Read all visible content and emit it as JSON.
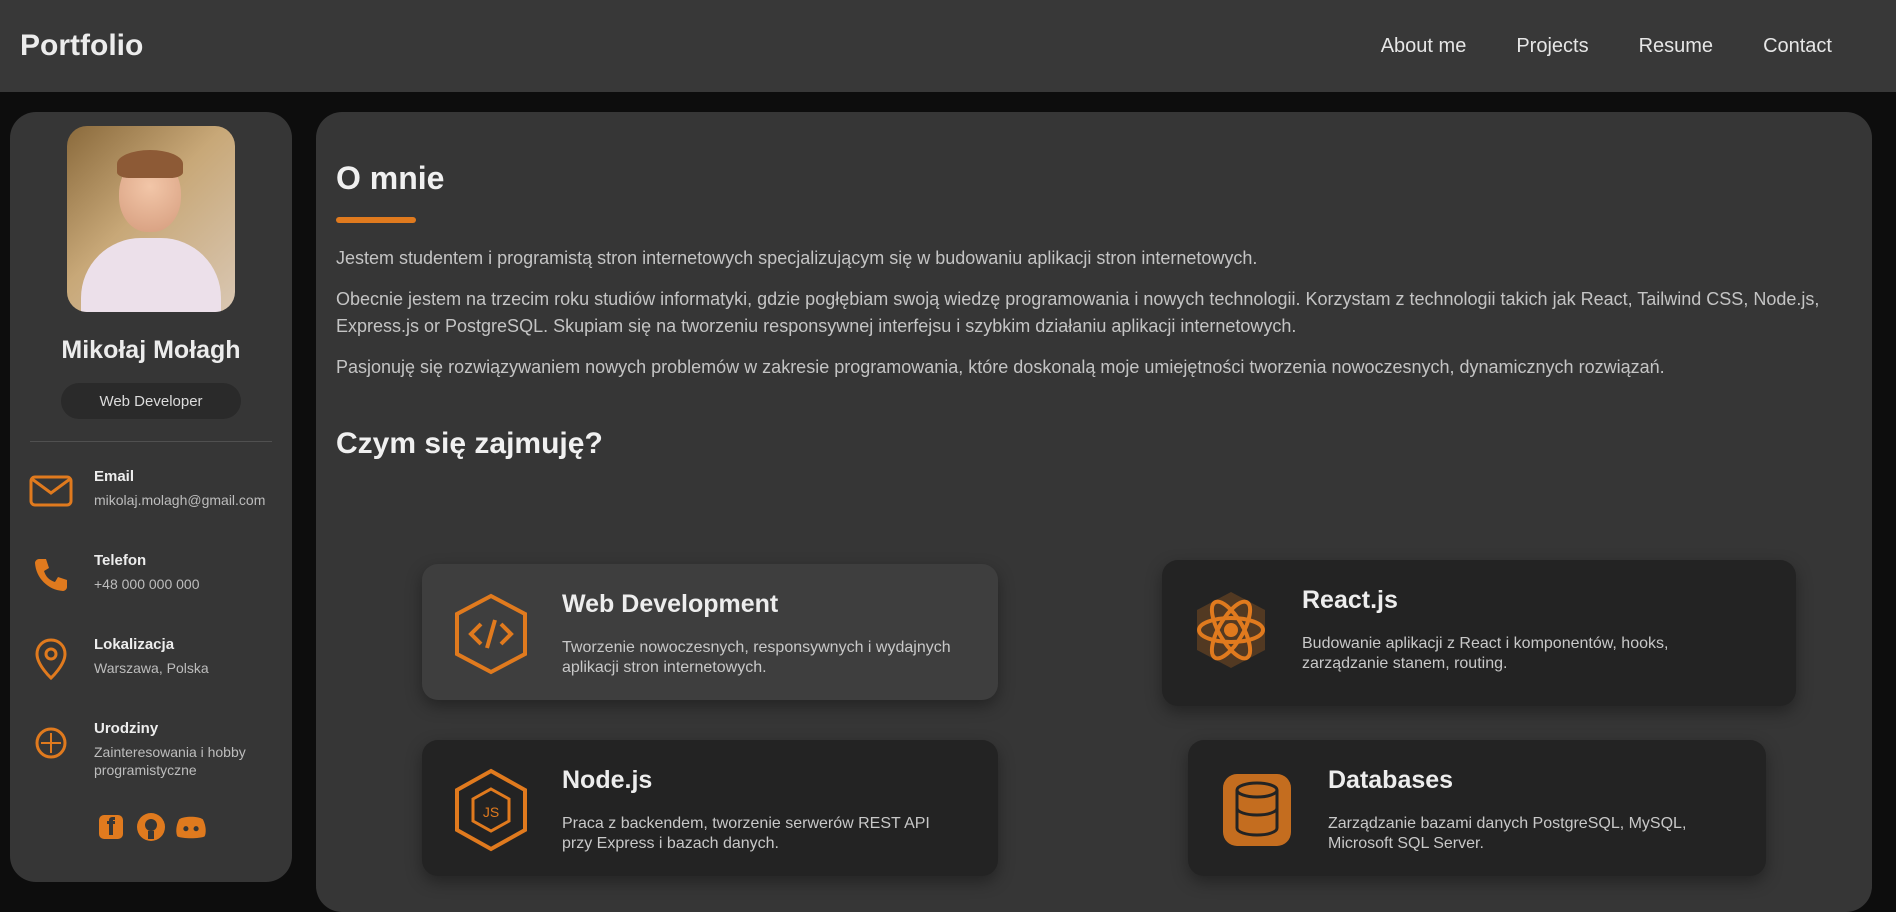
{
  "navbar": {
    "brand": "Portfolio",
    "links": [
      "About me",
      "Projects",
      "Resume",
      "Contact"
    ]
  },
  "sidebar": {
    "name": "Mikołaj Mołagh",
    "role": "Web Developer",
    "contacts": [
      {
        "label": "Email",
        "value": "mikolaj.molagh@gmail.com",
        "icon": "envelope-icon"
      },
      {
        "label": "Telefon",
        "value": "+48 000 000 000",
        "icon": "phone-icon"
      },
      {
        "label": "Lokalizacja",
        "value": "Warszawa, Polska",
        "icon": "location-pin-icon"
      },
      {
        "label": "Urodziny",
        "value": "Zainteresowania i hobby programistyczne",
        "icon": "birthday-icon"
      }
    ],
    "social": [
      "facebook-icon",
      "github-icon",
      "discord-icon"
    ]
  },
  "main": {
    "about_title": "O mnie",
    "paragraphs": [
      "Jestem studentem i programistą stron internetowych specjalizującym się w budowaniu aplikacji stron internetowych.",
      "Obecnie jestem na trzecim roku studiów informatyki, gdzie pogłębiam swoją wiedzę programowania i nowych technologii. Korzystam z technologii takich jak React, Tailwind CSS, Node.js, Express.js or PostgreSQL. Skupiam się na tworzeniu responsywnej interfejsu i szybkim działaniu aplikacji internetowych.",
      "Pasjonuję się rozwiązywaniem nowych problemów w zakresie programowania, które doskonalą moje umiejętności tworzenia nowoczesnych, dynamicznych rozwiązań."
    ],
    "services_title": "Czym się zajmuję?",
    "services": [
      {
        "title": "Web Development",
        "desc": "Tworzenie nowoczesnych, responsywnych i wydajnych aplikacji stron internetowych.",
        "icon": "hexagon-code-icon"
      },
      {
        "title": "React.js",
        "desc": "Budowanie aplikacji z React i komponentów, hooks, zarządzanie stanem, routing.",
        "icon": "react-atom-icon"
      },
      {
        "title": "Node.js",
        "desc": "Praca z backendem, tworzenie serwerów REST API przy Express i bazach danych.",
        "icon": "nodejs-hexagon-icon"
      },
      {
        "title": "Databases",
        "desc": "Zarządzanie bazami danych PostgreSQL, MySQL, Microsoft SQL Server.",
        "icon": "database-icon"
      }
    ]
  },
  "colors": {
    "accent": "#e07a1e",
    "panel": "#363636",
    "navbar": "#383838",
    "card_dark": "#232323",
    "card_light": "#3e3e3e"
  }
}
